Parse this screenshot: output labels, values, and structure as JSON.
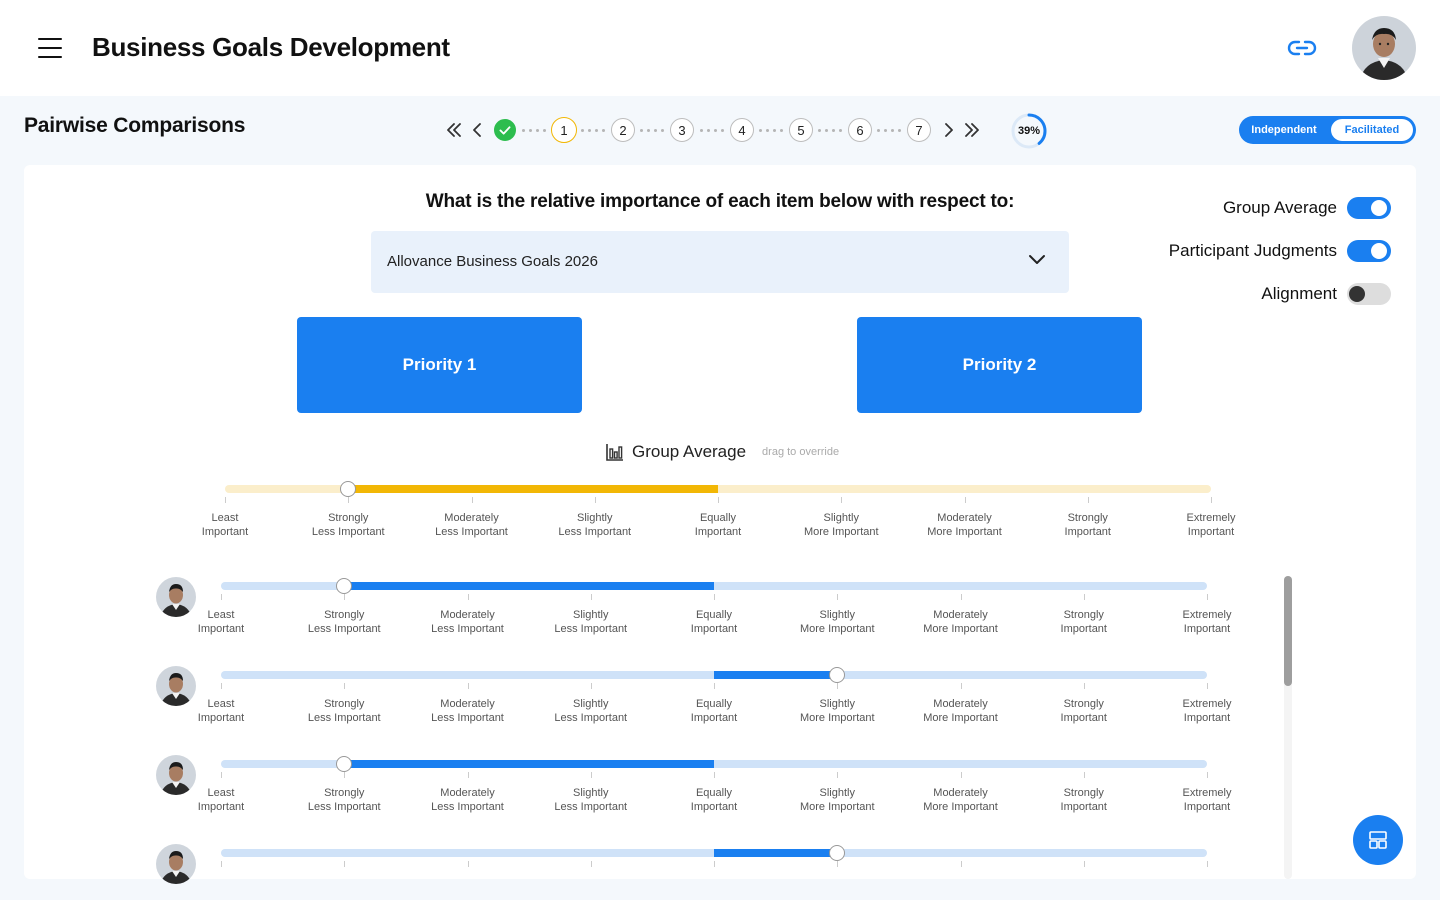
{
  "header": {
    "title": "Business Goals Development",
    "menu_icon": "hamburger-menu-icon",
    "link_icon": "link-icon"
  },
  "subheader": {
    "page_title": "Pairwise Comparisons",
    "steps": [
      "1",
      "2",
      "3",
      "4",
      "5",
      "6",
      "7"
    ],
    "current_step": "1",
    "progress_label": "39%",
    "progress": 0.39,
    "mode": {
      "independent": "Independent",
      "facilitated": "Facilitated",
      "selected": "Facilitated"
    }
  },
  "main": {
    "question": "What is the relative importance of each item below with respect to:",
    "dropdown_value": "Allovance Business Goals 2026",
    "toggles": {
      "group_average": {
        "label": "Group Average",
        "on": true
      },
      "participant_judgments": {
        "label": "Participant Judgments",
        "on": true
      },
      "alignment": {
        "label": "Alignment",
        "on": false
      }
    },
    "priority_1": "Priority 1",
    "priority_2": "Priority 2",
    "group_average_title": "Group Average",
    "group_average_hint": "drag to override",
    "scale": [
      [
        "Least",
        "Important"
      ],
      [
        "Strongly",
        "Less Important"
      ],
      [
        "Moderately",
        "Less Important"
      ],
      [
        "Slightly",
        "Less Important"
      ],
      [
        "Equally",
        "Important"
      ],
      [
        "Slightly",
        "More Important"
      ],
      [
        "Moderately",
        "More Important"
      ],
      [
        "Strongly",
        "Important"
      ],
      [
        "Extremely",
        "Important"
      ]
    ],
    "group_average_level": 1,
    "participants": [
      {
        "level": 1
      },
      {
        "level": 5
      },
      {
        "level": 1
      },
      {
        "level": 5
      }
    ]
  },
  "colors": {
    "accent": "#1a7ff0",
    "group": "#f2b705",
    "done": "#2dbd4e"
  }
}
